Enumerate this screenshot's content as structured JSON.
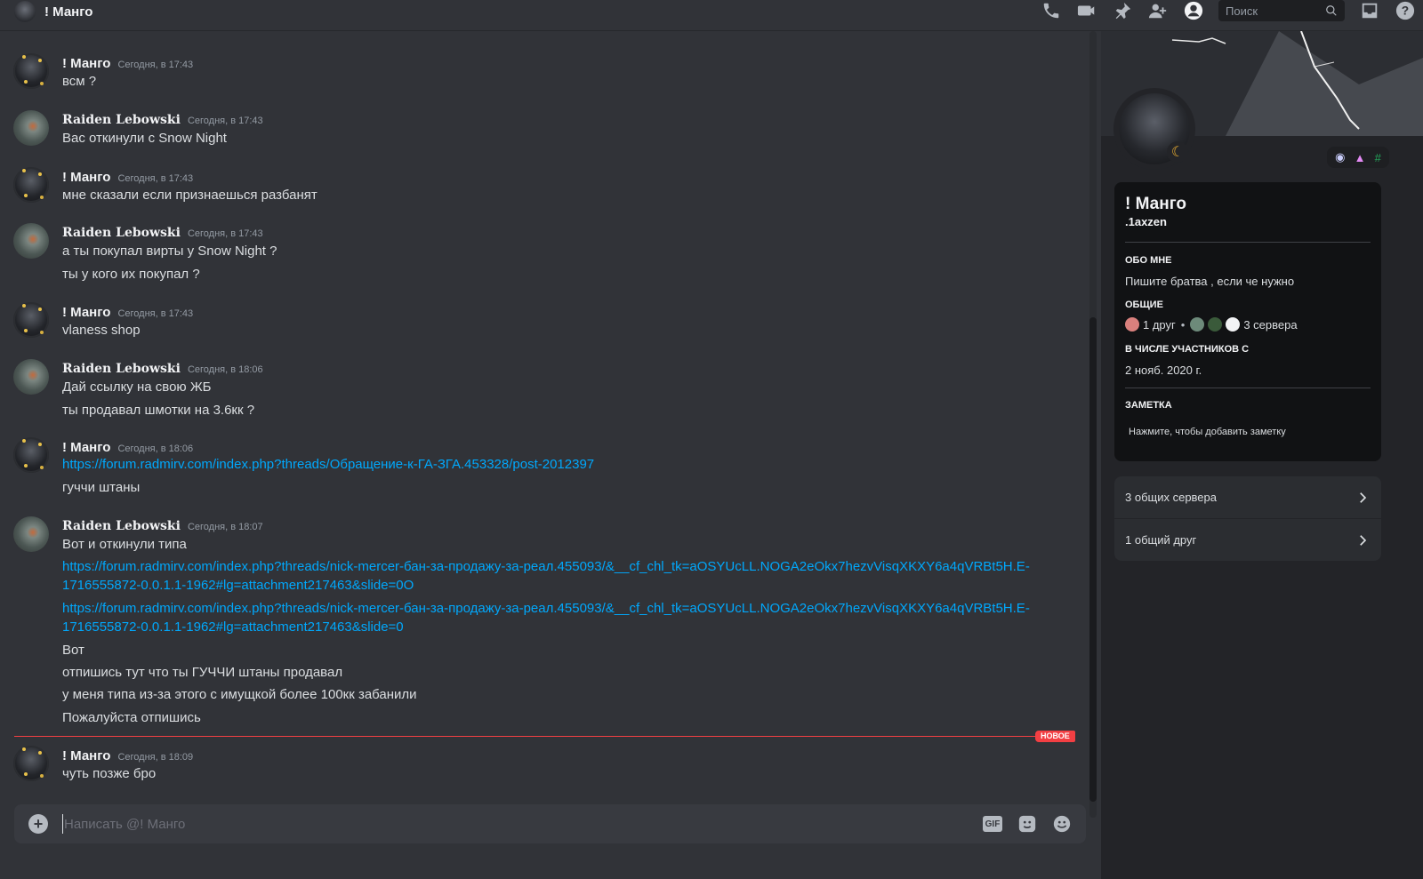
{
  "header": {
    "title": "! Манго",
    "icons": [
      "voice-call-icon",
      "video-call-icon",
      "pinned-messages-icon",
      "add-friends-icon",
      "user-profile-icon",
      "inbox-icon",
      "help-icon"
    ],
    "search_placeholder": "Поиск"
  },
  "messages": [
    {
      "author": "! Манго",
      "time": "Сегодня, в 17:43",
      "lines": [
        "всм ?"
      ]
    },
    {
      "author": "Raiden Lebowski",
      "time": "Сегодня, в 17:43",
      "lines": [
        "Вас откинули с Snow Night"
      ]
    },
    {
      "author": "! Манго",
      "time": "Сегодня, в 17:43",
      "lines": [
        "мне сказали если признаешься разбанят"
      ]
    },
    {
      "author": "Raiden Lebowski",
      "time": "Сегодня, в 17:43",
      "lines": [
        "а ты покупал вирты у Snow Night ?",
        "ты у кого их покупал ?"
      ]
    },
    {
      "author": "! Манго",
      "time": "Сегодня, в 17:43",
      "lines": [
        "vlaness shop"
      ]
    },
    {
      "author": "Raiden Lebowski",
      "time": "Сегодня, в 18:06",
      "lines": [
        "Дай ссылку на свою ЖБ",
        "ты продавал шмотки на 3.6кк ?"
      ]
    },
    {
      "author": "! Манго",
      "time": "Сегодня, в 18:06",
      "links": [
        "https://forum.radmirv.com/index.php?threads/Обращение-к-ГА-ЗГА.453328/post-2012397"
      ],
      "lines": [
        "гуччи штаны"
      ]
    },
    {
      "author": "Raiden Lebowski",
      "time": "Сегодня, в 18:07",
      "lines": [
        "Вот и откинули типа"
      ],
      "links": [
        "https://forum.radmirv.com/index.php?threads/nick-mercer-бан-за-продажу-за-реал.455093/&__cf_chl_tk=aOSYUcLL.NOGA2eOkx7hezvVisqXKXY6a4qVRBt5H.E-1716555872-0.0.1.1-1962#lg=attachment217463&slide=0O",
        "https://forum.radmirv.com/index.php?threads/nick-mercer-бан-за-продажу-за-реал.455093/&__cf_chl_tk=aOSYUcLL.NOGA2eOkx7hezvVisqXKXY6a4qVRBt5H.E-1716555872-0.0.1.1-1962#lg=attachment217463&slide=0"
      ],
      "tail": [
        "Вот",
        "отпишись тут что ты ГУЧЧИ штаны продавал",
        "у меня типа из-за этого с имущкой более 100кк забанили",
        "Пожалуйста отпишись"
      ]
    },
    {
      "author": "! Манго",
      "time": "Сегодня, в 18:09",
      "lines": [
        "чуть позже бро"
      ]
    }
  ],
  "new_badge": "НОВОЕ",
  "composer": {
    "placeholder": "Написать @! Манго",
    "gif_label": "GIF"
  },
  "profile": {
    "display_name": "! Манго",
    "username": ".1axzen",
    "about_label": "ОБО МНЕ",
    "about_text": "Пишите братва , если че нужно",
    "mutual_label": "ОБЩИЕ",
    "mutual_friends": "1 друг",
    "mutual_servers": "3 сервера",
    "member_since_label": "В ЧИСЛЕ УЧАСТНИКОВ С",
    "member_since": "2 нояб. 2020 г.",
    "note_label": "ЗАМЕТКА",
    "note_placeholder": "Нажмите, чтобы добавить заметку",
    "row_servers": "3 общих сервера",
    "row_friends": "1 общий друг"
  },
  "colors": {
    "accent_link": "#00a8fc",
    "new_divider": "#f23f43",
    "status_idle": "#f0b232"
  }
}
